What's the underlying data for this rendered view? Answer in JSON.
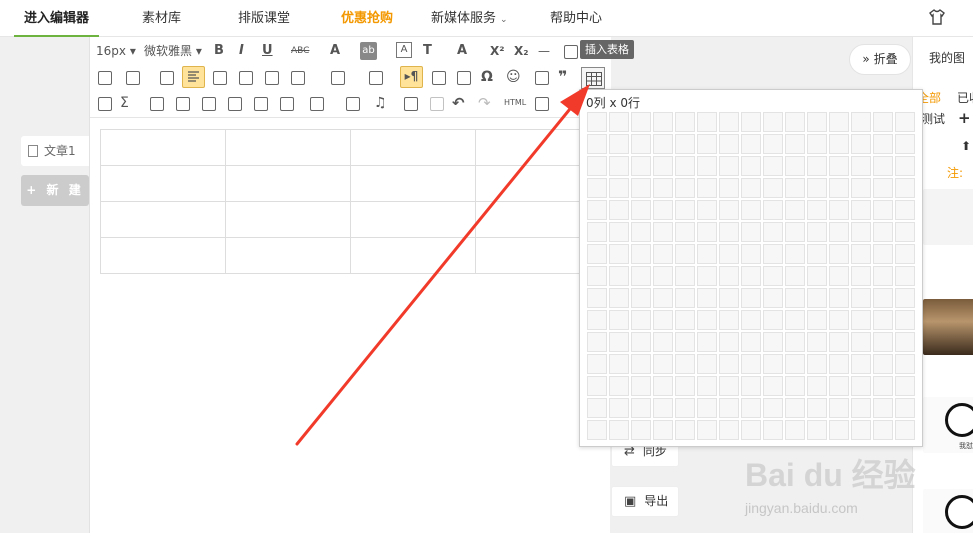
{
  "nav": {
    "items": [
      {
        "label": "进入编辑器",
        "state": "active"
      },
      {
        "label": "素材库"
      },
      {
        "label": "排版课堂"
      },
      {
        "label": "优惠抢购",
        "state": "promo"
      },
      {
        "label": "新媒体服务",
        "has_dropdown": true
      },
      {
        "label": "帮助中心"
      }
    ],
    "right_icon": "tshirt-icon"
  },
  "left_panel": {
    "doc_tab_label": "文章1",
    "new_button_label": "+ 新 建"
  },
  "toolbar": {
    "font_size": "16px",
    "font_family": "微软雅黑",
    "tooltip": "插入表格",
    "row1_glyphs": [
      "B",
      "I",
      "U",
      "ABC",
      "A",
      "ab",
      "A",
      "T",
      "A",
      "X²",
      "X₂",
      "—"
    ],
    "row3_html": "HTML"
  },
  "table_picker": {
    "selection_label": "0列 x 0行",
    "columns": 15,
    "rows": 15
  },
  "side_buttons": {
    "collapse_label": "折叠",
    "sync_label": "同步",
    "export_label": "导出"
  },
  "right_panel": {
    "title": "我的图",
    "tabs": [
      {
        "label": "全部",
        "color": "#f39800"
      },
      {
        "label": "已收",
        "color": "#333333"
      }
    ],
    "test_label": "测试",
    "note_label": "注:",
    "meme_caption": "我怼"
  },
  "watermark": {
    "text": "Bai du 经验",
    "url": "jingyan.baidu.com"
  },
  "colors": {
    "accent": "#6db33f",
    "promo": "#f39800",
    "arrow": "#f23a2a"
  }
}
